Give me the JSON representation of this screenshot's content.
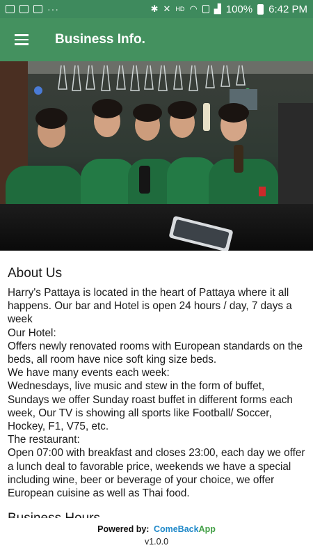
{
  "status_bar": {
    "battery": "100%",
    "time": "6:42 PM",
    "hd_label": "HD",
    "icons": [
      "image-icon",
      "facebook-icon",
      "news-icon",
      "more-dots-icon",
      "bluetooth-icon",
      "mute-icon",
      "wifi-icon",
      "sim-icon",
      "signal-icon",
      "battery-icon"
    ]
  },
  "app_bar": {
    "title": "Business Info.",
    "menu_icon": "hamburger-menu-icon"
  },
  "hero_image": {
    "description": "photo"
  },
  "about": {
    "title": "About Us",
    "paragraphs": [
      "Harry's Pattaya is located in the heart of Pattaya where it all happens. Our bar and Hotel is open 24 hours / day, 7 days a week",
      "Our Hotel:",
      "Offers newly renovated rooms with European standards on the beds, all room have nice soft king size beds.",
      "We have many events each week:",
      "Wednesdays, live music and stew in the form of buffet, Sundays we offer Sunday roast buffet in different forms each week, Our TV is showing all sports like Football/ Soccer, Hockey, F1, V75, etc.",
      "The restaurant:",
      "Open 07:00 with breakfast and closes 23:00, each day we offer a lunch deal to favorable price, weekends we have a special including wine, beer or beverage of your choice, we offer European cuisine as well as Thai food."
    ]
  },
  "business_hours": {
    "title": "Business Hours"
  },
  "footer": {
    "powered_label": "Powered by:",
    "brand_part1": "ComeBack",
    "brand_part2": "App",
    "version": "v1.0.0"
  },
  "colors": {
    "status_bar": "#3e8a5d",
    "app_bar": "#44915f",
    "brand_blue": "#1e88c8",
    "brand_green": "#43a047"
  }
}
